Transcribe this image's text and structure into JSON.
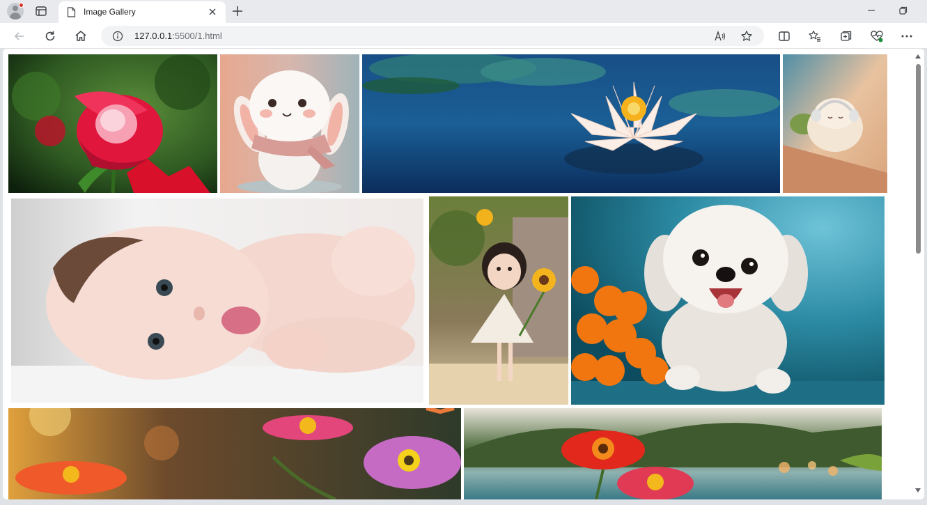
{
  "browser": {
    "tab": {
      "title": "Image Gallery"
    },
    "address": {
      "host": "127.0.0.1",
      "port_path": ":5500/1.html"
    },
    "icons": {
      "profile": "profile-avatar-icon",
      "tab_actions": "tab-actions-icon",
      "tab_page": "document-icon",
      "tab_close": "close-icon",
      "new_tab": "plus-icon",
      "back": "back-arrow-icon",
      "refresh": "refresh-icon",
      "home": "home-icon",
      "site_info": "info-icon",
      "read_aloud": "read-aloud-icon",
      "favorite": "star-icon",
      "split_screen": "split-screen-icon",
      "favorites": "favorites-icon",
      "collections": "collections-icon",
      "browser_essentials": "heart-pulse-icon",
      "menu": "more-icon",
      "minimize": "minimize-icon",
      "maximize": "restore-icon"
    },
    "colors": {
      "accent": "#1a73e8",
      "notification": "#d93025"
    }
  },
  "gallery": {
    "images": [
      {
        "name": "red-rose-image"
      },
      {
        "name": "bunny-image"
      },
      {
        "name": "water-lily-image"
      },
      {
        "name": "sheep-headphones-image"
      },
      {
        "name": "baby-image"
      },
      {
        "name": "girl-sunflower-image"
      },
      {
        "name": "puppy-image"
      },
      {
        "name": "gerbera-flowers-image"
      },
      {
        "name": "red-flowers-lake-image"
      }
    ]
  }
}
